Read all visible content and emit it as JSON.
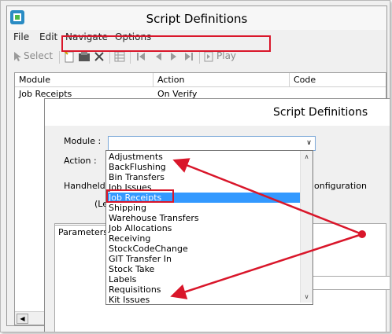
{
  "window": {
    "title": "Script Definitions"
  },
  "menu": [
    "File",
    "Edit",
    "Navigate",
    "Options"
  ],
  "toolbar": {
    "select": "Select",
    "play": "Play"
  },
  "grid": {
    "columns": [
      "Module",
      "Action",
      "Code"
    ],
    "rows": [
      {
        "module": "Job Receipts",
        "action": "On Verify",
        "code": ""
      }
    ]
  },
  "dialog": {
    "title": "Script Definitions",
    "module_label": "Module :",
    "action_label": "Action :",
    "handheld_partial": "Handheld/G",
    "configuration_partial": "onfiguration",
    "level_partial": "(Le",
    "tab_parameters": "Parameters"
  },
  "dropdown": {
    "options": [
      "Adjustments",
      "BackFlushing",
      "Bin Transfers",
      "Job Issues",
      "Job Receipts",
      "Shipping",
      "Warehouse Transfers",
      "Job Allocations",
      "Receiving",
      "StockCodeChange",
      "GIT Transfer In",
      "Stock Take",
      "Labels",
      "Requisitions",
      "Kit Issues"
    ],
    "selected": "Job Receipts"
  },
  "annotation_color": "#d9162a"
}
